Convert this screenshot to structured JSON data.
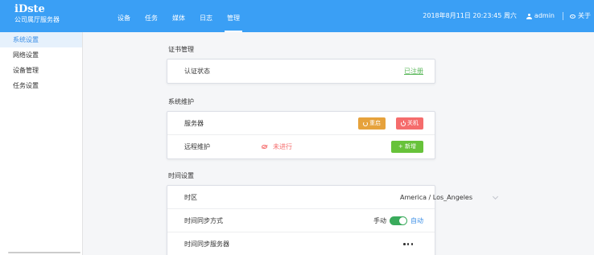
{
  "brand": {
    "title": "iDste",
    "subtitle": "公司属厅服务器"
  },
  "nav": {
    "items": [
      "设备",
      "任务",
      "媒体",
      "日志",
      "管理"
    ],
    "active_index": 4
  },
  "header": {
    "datetime": "2018年8月11日 20:23:45 周六",
    "username": "admin",
    "about": "关于"
  },
  "sidebar": {
    "items": [
      "系统设置",
      "网络设置",
      "设备管理",
      "任务设置"
    ],
    "active_index": 0
  },
  "cert": {
    "section_title": "证书管理",
    "label": "认证状态",
    "link": "已注册"
  },
  "maintenance": {
    "section_title": "系统维护",
    "server_label": "服务器",
    "restart_label": "重启",
    "shutdown_label": "关机",
    "remote_label": "远程维护",
    "remote_status": "未进行",
    "add_label": "+ 新增"
  },
  "time": {
    "section_title": "时间设置",
    "timezone_label": "时区",
    "timezone_value": "America / Los_Angeles",
    "sync_mode_label": "时间同步方式",
    "sync_manual": "手动",
    "sync_auto": "自动",
    "sync_server_label": "时间同步服务器"
  },
  "colors": {
    "header": "#3a9ff5",
    "accent": "#3a8ee6",
    "success": "#67c23a",
    "warning": "#e6a23c",
    "danger": "#f56c6c"
  }
}
